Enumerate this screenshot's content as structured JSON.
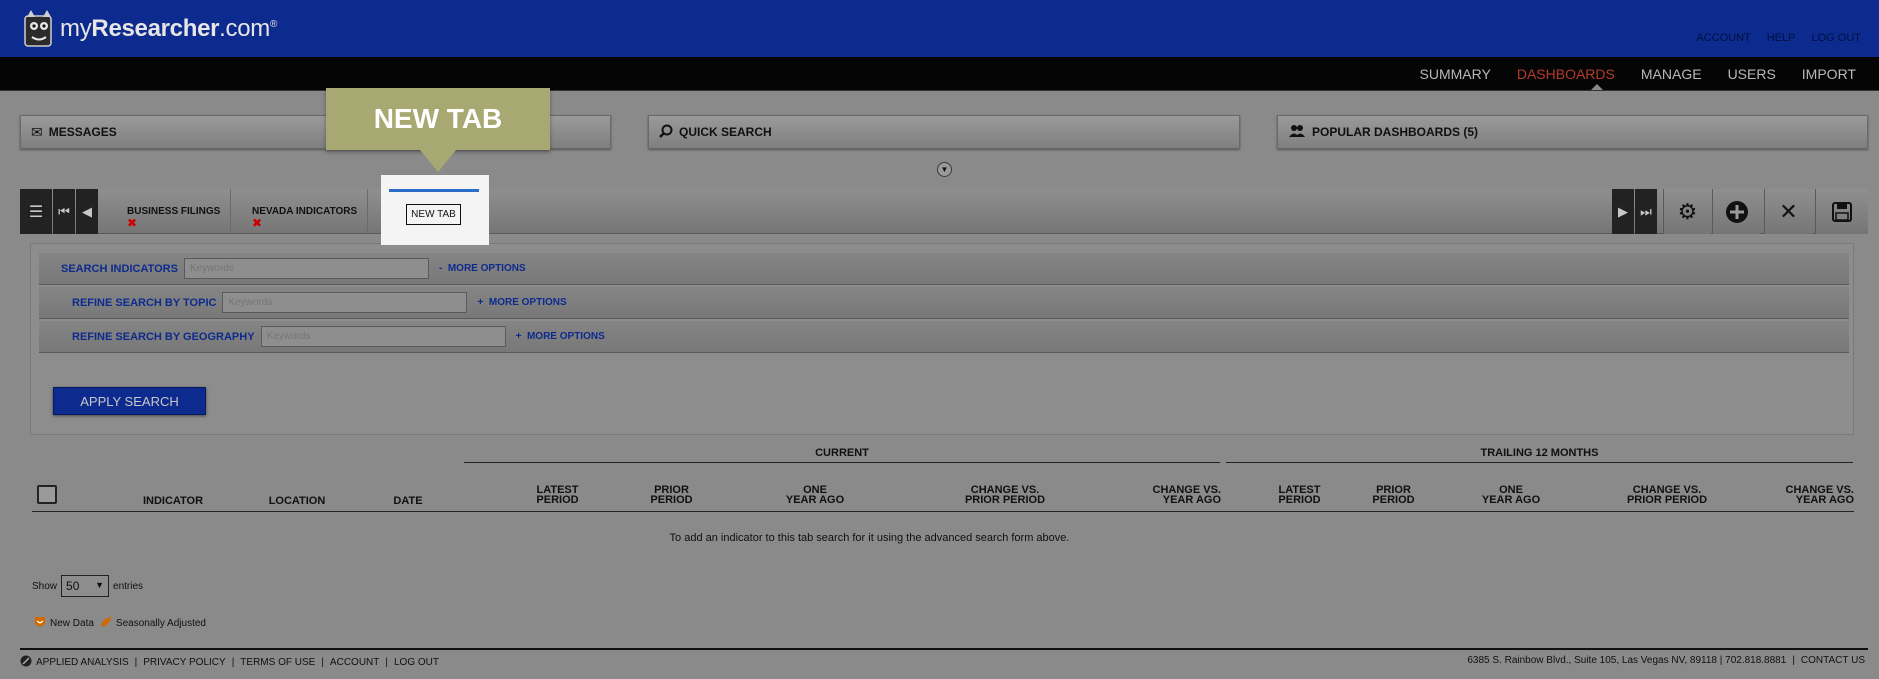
{
  "brand": {
    "name_regular": "my",
    "name_bold": "Researcher",
    "name_suffix": ".com",
    "mark": "®"
  },
  "top_links": [
    "ACCOUNT",
    "HELP",
    "LOG OUT"
  ],
  "nav": {
    "items": [
      {
        "label": "SUMMARY",
        "active": false
      },
      {
        "label": "DASHBOARDS",
        "active": true
      },
      {
        "label": "MANAGE",
        "active": false
      },
      {
        "label": "USERS",
        "active": false
      },
      {
        "label": "IMPORT",
        "active": false
      }
    ]
  },
  "panels": {
    "messages": "MESSAGES",
    "quick_search": "QUICK SEARCH",
    "popular_dashboards": "POPULAR DASHBOARDS (5)"
  },
  "callout": {
    "text": "NEW TAB"
  },
  "tabs": [
    {
      "label": "BUSINESS FILINGS",
      "close": "✖"
    },
    {
      "label": "NEVADA INDICATORS",
      "close": "✖"
    },
    {
      "label": "NEW TAB",
      "close": ""
    }
  ],
  "search": {
    "rows": [
      {
        "label": "SEARCH INDICATORS",
        "placeholder": "Keywords",
        "toggle": "-",
        "more": "MORE OPTIONS"
      },
      {
        "label": "REFINE SEARCH BY TOPIC",
        "placeholder": "Keywords",
        "toggle": "+",
        "more": "MORE OPTIONS"
      },
      {
        "label": "REFINE SEARCH BY GEOGRAPHY",
        "placeholder": "Keywords",
        "toggle": "+",
        "more": "MORE OPTIONS"
      }
    ],
    "apply_label": "APPLY SEARCH"
  },
  "table": {
    "groups": {
      "current": "CURRENT",
      "trailing": "TRAILING 12 MONTHS"
    },
    "columns": {
      "indicator": "INDICATOR",
      "location": "LOCATION",
      "date": "DATE",
      "cur_latest": [
        "LATEST",
        "PERIOD"
      ],
      "cur_prior": [
        "PRIOR",
        "PERIOD"
      ],
      "cur_one_year": [
        "ONE",
        "YEAR AGO"
      ],
      "cur_change_prior": [
        "CHANGE VS.",
        "PRIOR PERIOD"
      ],
      "cur_change_year": [
        "CHANGE VS.",
        "YEAR AGO"
      ],
      "tr_latest": [
        "LATEST",
        "PERIOD"
      ],
      "tr_prior": [
        "PRIOR",
        "PERIOD"
      ],
      "tr_one_year": [
        "ONE",
        "YEAR AGO"
      ],
      "tr_change_prior": [
        "CHANGE VS.",
        "PRIOR PERIOD"
      ],
      "tr_change_year": [
        "CHANGE VS.",
        "YEAR AGO"
      ]
    },
    "empty_message": "To add an indicator to this tab search for it using the advanced search form above."
  },
  "entries": {
    "show": "Show",
    "value": "50",
    "suffix": "entries"
  },
  "legend": {
    "new_data": "New Data",
    "seasonally_adjusted": "Seasonally Adjusted"
  },
  "footer": {
    "left": [
      "APPLIED ANALYSIS",
      "PRIVACY POLICY",
      "TERMS OF USE",
      "ACCOUNT",
      "LOG OUT"
    ],
    "address": "6385 S. Rainbow Blvd., Suite 105, Las Vegas NV, 89118 | 702.818.8881",
    "contact": "CONTACT US"
  },
  "colors": {
    "header_blue": "#0d2a8e",
    "active_nav": "#b33a2e",
    "callout": "#a8a872",
    "tab_accent": "#2a6cc7"
  }
}
